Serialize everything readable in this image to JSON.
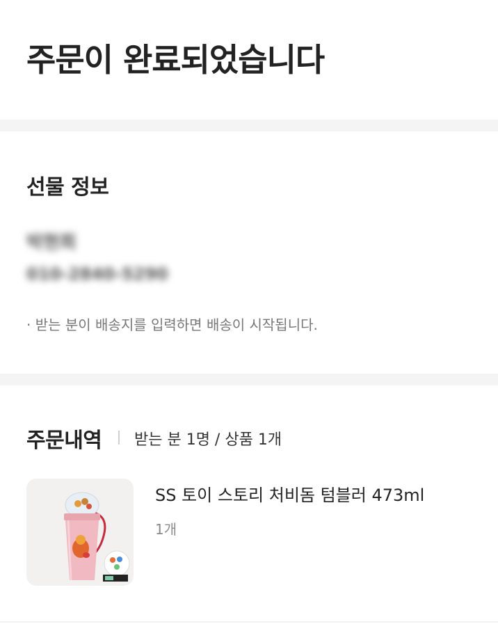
{
  "page_title": "주문이 완료되었습니다",
  "gift_info": {
    "heading": "선물 정보",
    "recipient_name": "박현희",
    "recipient_phone": "010-2840-5290",
    "notice": "· 받는 분이 배송지를 입력하면 배송이 시작됩니다."
  },
  "order": {
    "heading": "주문내역",
    "summary": "받는 분 1명 / 상품 1개",
    "items": [
      {
        "name": "SS 토이 스토리 처비돔 텀블러 473ml",
        "quantity": "1개",
        "thumbnail_icon": "tumbler-product-image"
      }
    ]
  },
  "colors": {
    "background": "#ffffff",
    "divider": "#f4f4f4",
    "text_primary": "#222222",
    "text_secondary": "#777777",
    "thumb_bg": "#f2f1ef"
  }
}
